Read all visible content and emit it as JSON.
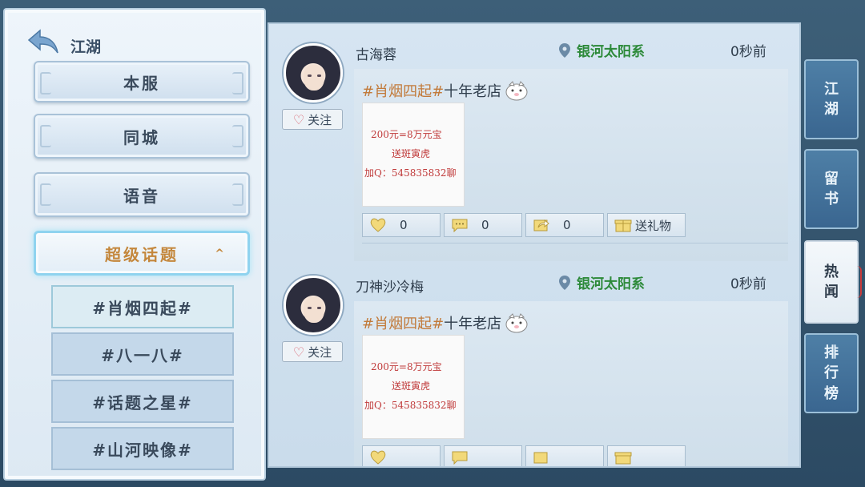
{
  "nav": {
    "back_label": "江湖"
  },
  "menu": {
    "items": [
      {
        "label": "本服"
      },
      {
        "label": "同城"
      },
      {
        "label": "语音"
      },
      {
        "label": "超级话题"
      }
    ],
    "expanded_caret": "^"
  },
  "topics": [
    {
      "label": "#肖烟四起#"
    },
    {
      "label": "#八一八#"
    },
    {
      "label": "#话题之星#"
    },
    {
      "label": "#山河映像#"
    }
  ],
  "posts": [
    {
      "username": "古海蓉",
      "location": "银河太阳系",
      "time": "0秒前",
      "follow": "关注",
      "title_tag": "#肖烟四起#",
      "title_rest": "十年老店",
      "image_lines": [
        "200元=8万元宝",
        "送斑寅虎",
        "加Q：545835832聊"
      ],
      "likes": "0",
      "comments": "0",
      "shares": "0",
      "gift_label": "送礼物"
    },
    {
      "username": "刀神沙冷梅",
      "location": "银河太阳系",
      "time": "0秒前",
      "follow": "关注",
      "title_tag": "#肖烟四起#",
      "title_rest": "十年老店",
      "image_lines": [
        "200元=8万元宝",
        "送斑寅虎",
        "加Q：545835832聊"
      ],
      "likes": "",
      "comments": "",
      "shares": "",
      "gift_label": ""
    }
  ],
  "tabs": [
    {
      "label_1": "江",
      "label_2": "湖",
      "label_3": ""
    },
    {
      "label_1": "留",
      "label_2": "书",
      "label_3": ""
    },
    {
      "label_1": "热",
      "label_2": "闻",
      "label_3": ""
    },
    {
      "label_1": "排",
      "label_2": "行",
      "label_3": "榜"
    }
  ],
  "colors": {
    "accent_gold": "#c4873c",
    "location_green": "#2d8a3a",
    "tab_blue": "#3a6690"
  }
}
